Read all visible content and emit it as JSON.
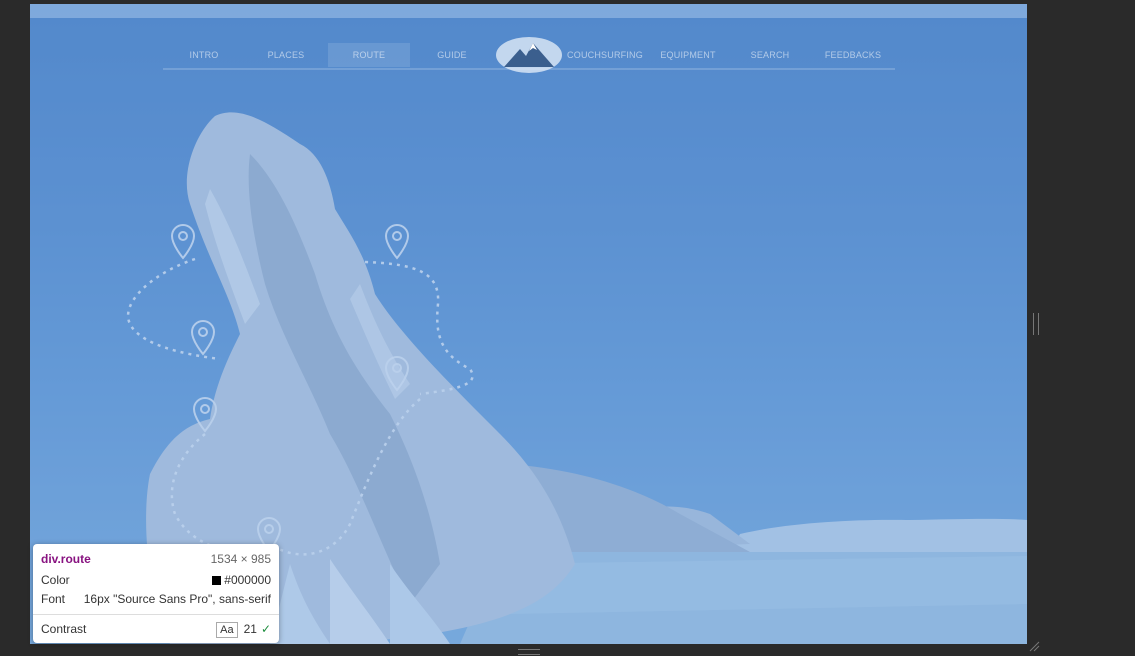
{
  "nav": {
    "items": [
      {
        "label": "INTRO",
        "active": false
      },
      {
        "label": "PLACES",
        "active": false
      },
      {
        "label": "ROUTE",
        "active": true
      },
      {
        "label": "GUIDE",
        "active": false
      },
      {
        "label": "COUCHSURFING",
        "active": false
      },
      {
        "label": "EQUIPMENT",
        "active": false
      },
      {
        "label": "SEARCH",
        "active": false
      },
      {
        "label": "FEEDBACKS",
        "active": false
      }
    ]
  },
  "tooltip": {
    "selector": "div.route",
    "size": "1534 × 985",
    "color_label": "Color",
    "color_value": "#000000",
    "font_label": "Font",
    "font_value": "16px \"Source Sans Pro\", sans-serif",
    "contrast_label": "Contrast",
    "contrast_aa": "Aa",
    "contrast_value": "21"
  },
  "colors": {
    "overlay_blue": "#5b8fd0",
    "rock_light": "#c6d4e6",
    "tooltip_selector": "#881280"
  },
  "icons": [
    "map-pin-icon",
    "mountain-logo-icon",
    "checkmark-icon",
    "resize-handle-icon"
  ]
}
